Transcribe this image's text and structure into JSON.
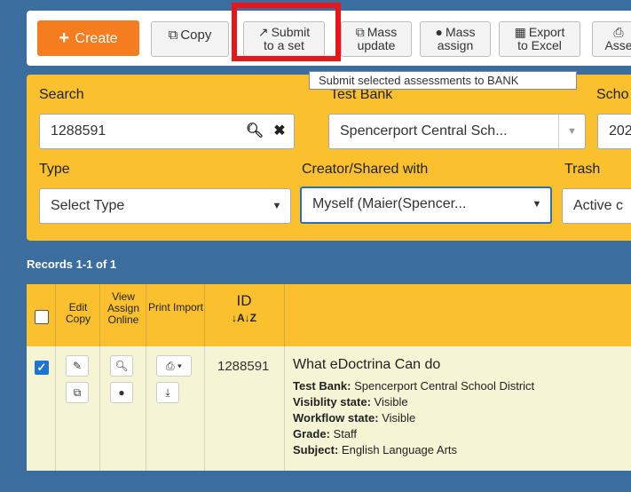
{
  "toolbar": {
    "create_label": "Create",
    "copy_label": "Copy",
    "submit_line1": "Submit",
    "submit_line2": "to a set",
    "mass_update_line1": "Mass",
    "mass_update_line2": "update",
    "mass_assign_line1": "Mass",
    "mass_assign_line2": "assign",
    "export_line1": "Export",
    "export_line2": "to Excel",
    "assess_line2": "Asse"
  },
  "tooltip": "Submit selected assessments to BANK",
  "filters": {
    "search_label": "Search",
    "search_value": "1288591",
    "testbank_label": "Test Bank",
    "testbank_value": "Spencerport Central Sch...",
    "school_label": "Scho",
    "school_value": "202",
    "type_label": "Type",
    "type_value": "Select Type",
    "creator_label": "Creator/Shared with",
    "creator_value": "Myself (Maier(Spencer...",
    "trash_label": "Trash",
    "trash_value": "Active c"
  },
  "records_label": "Records 1-1 of 1",
  "table": {
    "col_edit": "Edit Copy",
    "col_view": "View Assign Online",
    "col_print": "Print Import",
    "col_id": "ID",
    "row": {
      "id": "1288591",
      "title": "What eDoctrina Can do",
      "details": [
        {
          "key": "Test Bank:",
          "value": "Spencerport Central School District"
        },
        {
          "key": "Visiblity state:",
          "value": "Visible"
        },
        {
          "key": "Workflow state:",
          "value": "Visible"
        },
        {
          "key": "Grade:",
          "value": "Staff"
        },
        {
          "key": "Subject:",
          "value": "English Language Arts"
        }
      ]
    }
  }
}
